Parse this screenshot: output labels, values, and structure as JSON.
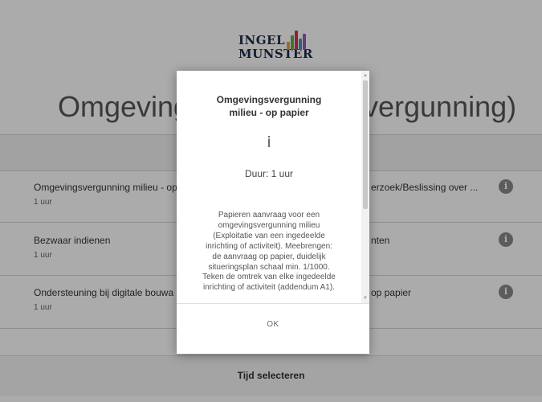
{
  "logo": {
    "line1": "INGEL",
    "line2": "MUNSTER",
    "bar_colors": [
      "#e8a33d",
      "#5fb04a",
      "#d6334b",
      "#4a8fd0",
      "#9b59b6"
    ]
  },
  "page": {
    "title_left": "Omgevings",
    "title_right": "vergunning)"
  },
  "items": [
    {
      "title": "Omgevingsvergunning milieu - op",
      "duration": "1 uur",
      "right_title": "erzoek/Beslissing over ...",
      "info_icon": "info-icon"
    },
    {
      "title": "Bezwaar indienen",
      "duration": "1 uur",
      "right_title": "nten",
      "info_icon": "info-icon"
    },
    {
      "title": "Ondersteuning bij digitale bouwa",
      "duration": "1 uur",
      "right_title": "op papier",
      "info_icon": "info-icon"
    }
  ],
  "footer": {
    "select_label": "Tijd selecteren"
  },
  "modal": {
    "title_line1": "Omgevingsvergunning",
    "title_line2": "milieu - op papier",
    "info_symbol": "i",
    "duration": "Duur: 1 uur",
    "description_lines": [
      "Papieren aanvraag voor een",
      "omgevingsvergunning milieu",
      "(Exploitatie van een ingedeelde",
      "inrichting of activiteit). Meebrengen:",
      "de aanvraag op papier, duidelijk",
      "situeringsplan schaal min. 1/1000.",
      "Teken de omtrek van elke ingedeelde",
      "inrichting of activiteit (addendum A1)."
    ],
    "ok_label": "OK"
  },
  "colors": {
    "overlay": "rgba(0,0,0,0.33)",
    "info_button": "#8a8a8a",
    "band": "#f2f2f2"
  }
}
